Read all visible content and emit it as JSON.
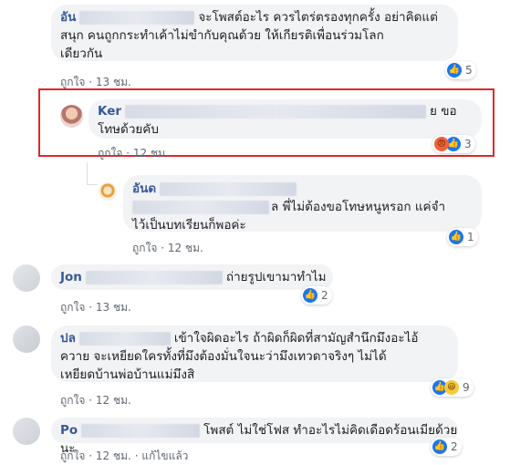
{
  "comments": [
    {
      "name": "อัน",
      "text": "จะโพสต์อะไร ควรไตร่ตรองทุกครั้ง อย่าคิดแต่สนุก คนถูกกระทำเค้าไม่ขำกับคุณด้วย ให้เกียรติเพื่อนร่วมโลกเดียวกัน",
      "text_l1": "จะโพสต์อะไร ควรไตร่ตรองทุกครั้ง อย่าคิดแต่",
      "text_l2": "สนุก คนถูกกระทำเค้าไม่ขำกับคุณด้วย ให้เกียรติเพื่อนร่วมโลก",
      "text_l3": "เดียวกัน",
      "like_label": "ถูกใจ",
      "time": "13 ชม.",
      "reaction_count": "5"
    },
    {
      "name": "Ker",
      "text_tail": "ย ขอ",
      "text_l2": "โทษด้วยคับ",
      "like_label": "ถูกใจ",
      "time": "12 ชม.",
      "reaction_count": "3"
    },
    {
      "name": "อันด",
      "text_l1_tail": "ล พี่ไม่ต้องขอโทษหนูหรอก แค่จำ",
      "text_l2": "ไว้เป็นบทเรียนก็พอค่ะ",
      "like_label": "ถูกใจ",
      "time": "12 ชม.",
      "reaction_count": "1"
    },
    {
      "name": "Jon",
      "text": "ถ่ายรูปเขามาทำไม",
      "like_label": "ถูกใจ",
      "time": "13 ชม.",
      "reaction_count": "2"
    },
    {
      "name": "ปล",
      "text_l1": "เข้าใจผิดอะไร ถ้าผิดก็ผิดที่สามัญสำนึกมึงอะไอ้",
      "text_l2": "ควาย จะเหยียดใครทั้งที่มึงต้องมั่นใจนะว่ามึงเทวดาจริงๆ ไม่ได้",
      "text_l3": "เหยียดบ้านพ่อบ้านแม่มึงสิ",
      "like_label": "ถูกใจ",
      "time": "12 ชม.",
      "reaction_count": "9"
    },
    {
      "name": "Po",
      "text": "โพสต์ ไม่ใช่โฟส ทำอะไรไม่คิดเดือดร้อนเมียด้วยนะ",
      "like_label": "ถูกใจ",
      "time": "12 ชม.",
      "edited": "แก้ไขแล้ว",
      "reaction_count": "2"
    }
  ],
  "separator": "·",
  "icons": {
    "like": "like-icon",
    "angry": "angry-icon",
    "haha": "haha-icon"
  },
  "colors": {
    "name": "#385898",
    "bubble": "#f2f3f5",
    "highlight": "#e0282a",
    "like": "#1877f2"
  }
}
